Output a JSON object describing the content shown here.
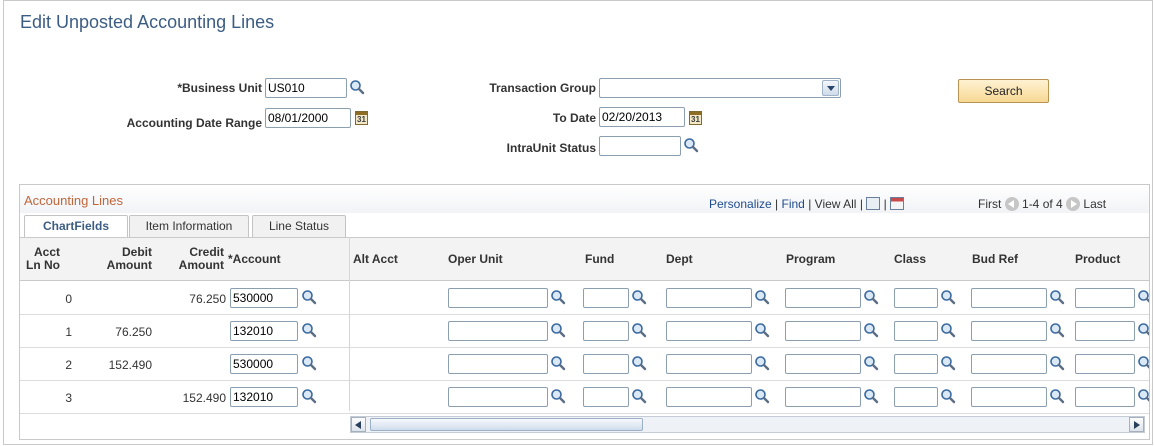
{
  "page": {
    "title": "Edit Unposted Accounting Lines"
  },
  "search": {
    "business_unit_label": "*Business Unit",
    "business_unit_value": "US010",
    "accounting_date_range_label": "Accounting Date Range",
    "accounting_date_from": "08/01/2000",
    "transaction_group_label": "Transaction Group",
    "transaction_group_value": "",
    "to_date_label": "To Date",
    "to_date_value": "02/20/2013",
    "intraunit_status_label": "IntraUnit Status",
    "intraunit_status_value": "",
    "search_button": "Search"
  },
  "grid": {
    "title": "Accounting Lines",
    "personalize": "Personalize",
    "find": "Find",
    "view_all": "View All",
    "first": "First",
    "range": "1-4 of 4",
    "last": "Last",
    "sep": "|",
    "tabs": [
      "ChartFields",
      "Item Information",
      "Line Status"
    ],
    "columns": [
      "Acct Ln No",
      "Debit Amount",
      "Credit Amount",
      "*Account",
      "Alt Acct",
      "Oper Unit",
      "Fund",
      "Dept",
      "Program",
      "Class",
      "Bud Ref",
      "Product"
    ],
    "rows": [
      {
        "ln": "0",
        "debit": "",
        "credit": "76.250",
        "account": "530000"
      },
      {
        "ln": "1",
        "debit": "76.250",
        "credit": "",
        "account": "132010"
      },
      {
        "ln": "2",
        "debit": "152.490",
        "credit": "",
        "account": "530000"
      },
      {
        "ln": "3",
        "debit": "",
        "credit": "152.490",
        "account": "132010"
      }
    ]
  },
  "icons": {
    "lookup": "magnifier-icon",
    "calendar": "calendar-icon",
    "dropdown": "chevron-down-icon"
  },
  "colors": {
    "title": "#3c5d83",
    "grid_title": "#c0663b",
    "link": "#1f4b8e",
    "button": "#f7d894"
  }
}
